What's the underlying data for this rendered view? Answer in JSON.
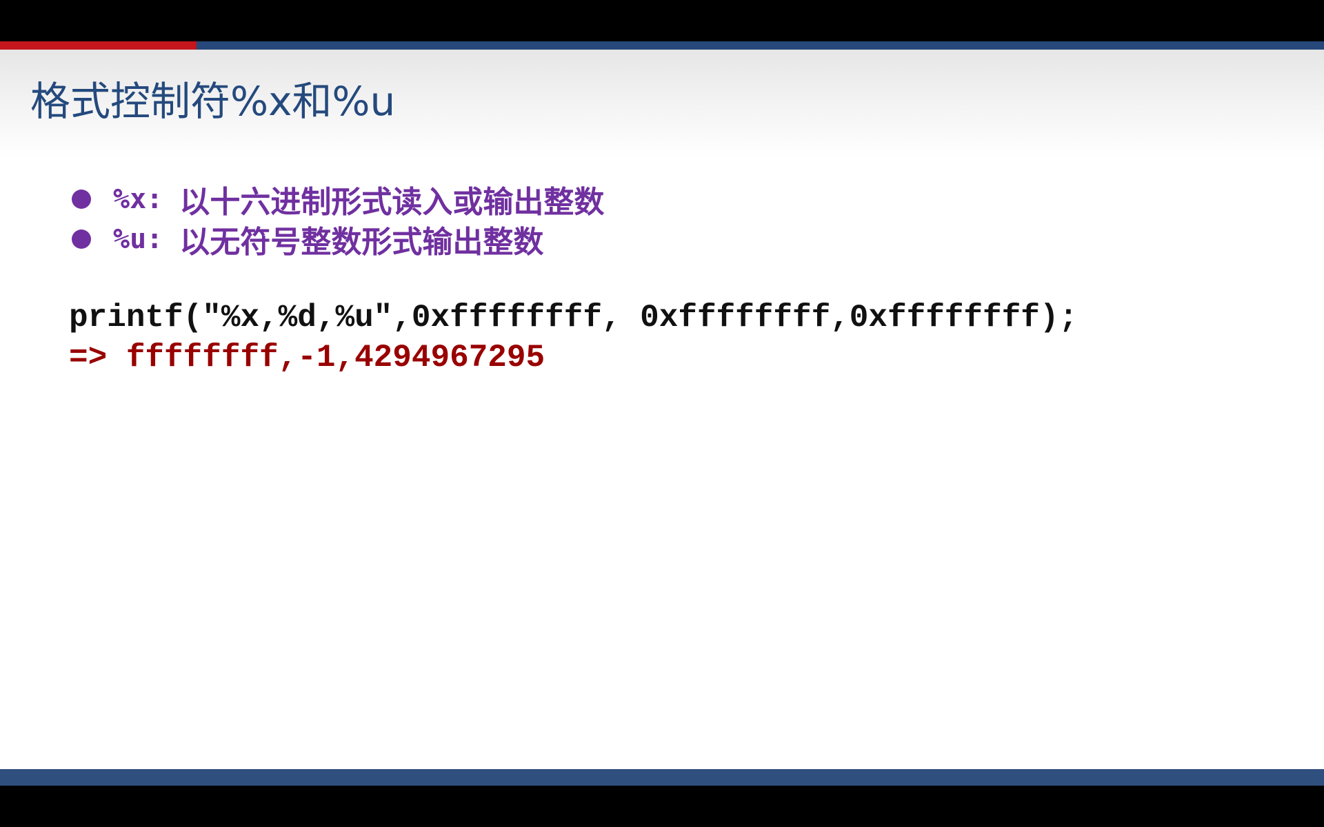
{
  "slide": {
    "title": "格式控制符%x和%u",
    "bullets": [
      {
        "code": "%x: ",
        "text": "以十六进制形式读入或输出整数"
      },
      {
        "code": "%u: ",
        "text": "以无符号整数形式输出整数"
      }
    ],
    "code": {
      "call": "printf(\"%x,%d,%u\",0xffffffff, 0xffffffff,0xffffffff);",
      "result": "=> ffffffff,-1,4294967295"
    }
  },
  "colors": {
    "title": "#24497d",
    "bullet": "#7030a0",
    "code": "#111111",
    "result": "#990000",
    "accent_red": "#c4161c",
    "accent_blue": "#26487a"
  }
}
